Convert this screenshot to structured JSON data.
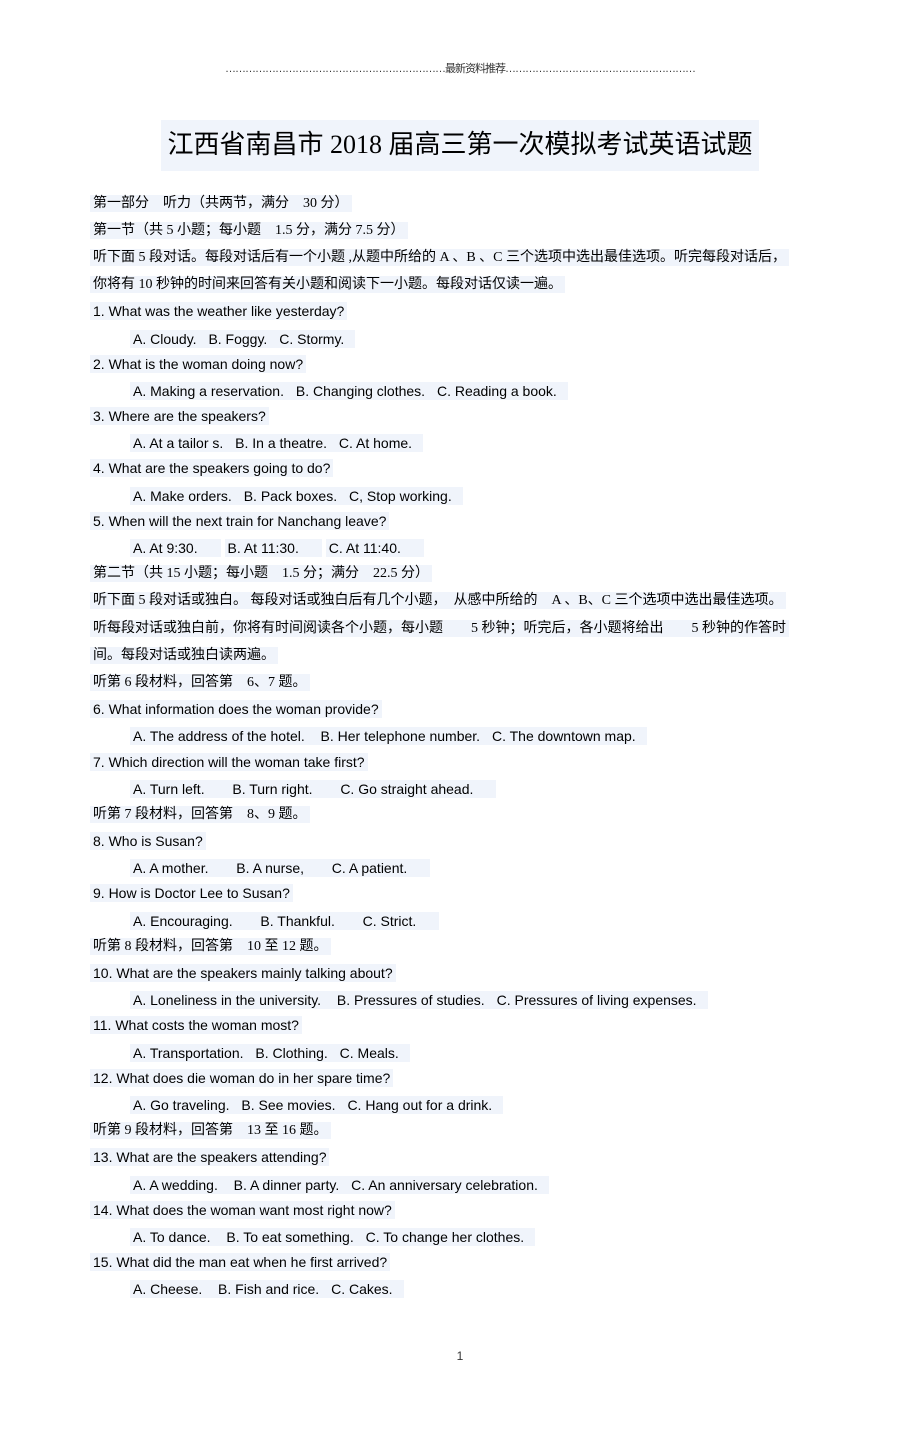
{
  "header_dots": "…………………………………………………………最新资料推荐…………………………………………………",
  "title": "江西省南昌市 2018 届高三第一次模拟考试英语试题",
  "part1_header": "第一部分　听力（共两节，满分　30 分）",
  "section1_header": "第一节（共 5 小题；每小题　1.5 分，满分 7.5 分）",
  "section1_instruction_a": "听下面 5 段对话。每段对话后有一个小题 ,从题中所给的 A 、B 、C 三个选项中选出最佳选项。听完每段对话后，",
  "section1_instruction_b": "你将有 10 秒钟的时间来回答有关小题和阅读下一小题。每段对话仅读一遍。",
  "q1": {
    "text": "1. What was the weather like yesterday?",
    "opts": [
      "A. Cloudy.",
      "B. Foggy.",
      "C. Stormy."
    ]
  },
  "q2": {
    "text": "2. What is the woman doing now?",
    "opts": [
      "A. Making a reservation.",
      "B. Changing clothes.",
      "C. Reading a book."
    ]
  },
  "q3": {
    "text": "3. Where are the speakers?",
    "opts": [
      "A. At a tailor s.",
      "B. In a theatre.",
      "C. At home."
    ]
  },
  "q4": {
    "text": "4. What are the speakers going to do?",
    "opts": [
      "A. Make orders.",
      "B. Pack boxes.",
      "C, Stop working."
    ]
  },
  "q5": {
    "text": "5. When will the next train for Nanchang leave?",
    "opts": [
      "A. At 9:30.",
      "B. At 11:30.",
      "C. At 11:40."
    ]
  },
  "section2_header": "第二节（共 15 小题；每小题　1.5 分；满分　22.5 分）",
  "section2_instruction_a": "听下面 5 段对话或独白。 每段对话或独白后有几个小题，　从感中所给的　A 、B、C 三个选项中选出最佳选项。",
  "section2_instruction_b": "听每段对话或独白前，你将有时间阅读各个小题，每小题　　5 秒钟；听完后，各小题将给出　　5 秒钟的作答时",
  "section2_instruction_c": "间。每段对话或独白读两遍。",
  "material6": "听第 6 段材料，回答第　6、7 题。",
  "q6": {
    "text": "6. What information does the woman provide?",
    "opts": [
      "A. The address of the hotel.",
      "B. Her telephone number.",
      "C. The downtown map."
    ]
  },
  "q7": {
    "text": "7. Which direction will the woman take first?",
    "opts": [
      "A. Turn left.",
      "B. Turn right.",
      "C. Go straight ahead."
    ]
  },
  "material7": "听第 7 段材料，回答第　8、9 题。",
  "q8": {
    "text": "8. Who is Susan?",
    "opts": [
      "A. A mother.",
      "B. A nurse,",
      "C. A patient."
    ]
  },
  "q9": {
    "text": "9. How is Doctor Lee to Susan?",
    "opts": [
      "A. Encouraging.",
      "B. Thankful.",
      "C. Strict."
    ]
  },
  "material8": "听第 8 段材料，回答第　10 至 12 题。",
  "q10": {
    "text": "10. What are the speakers mainly talking about?",
    "opts": [
      "A. Loneliness in the university.",
      "B. Pressures of studies.",
      "C. Pressures of living expenses."
    ]
  },
  "q11": {
    "text": "11. What costs the woman most?",
    "opts": [
      "A. Transportation.",
      "B. Clothing.",
      "C. Meals."
    ]
  },
  "q12": {
    "text": "12. What does die woman do in her spare time?",
    "opts": [
      "A. Go traveling.",
      "B. See movies.",
      "C. Hang out for a drink."
    ]
  },
  "material9": "听第 9 段材料，回答第　13 至 16 题。",
  "q13": {
    "text": "13. What are the speakers attending?",
    "opts": [
      "A. A wedding.",
      "B. A dinner party.",
      "C. An anniversary celebration."
    ]
  },
  "q14": {
    "text": "14. What does the woman want most right now?",
    "opts": [
      "A. To dance.",
      "B. To eat something.",
      "C. To change her clothes."
    ]
  },
  "q15": {
    "text": "15. What did the man eat when he first arrived?",
    "opts": [
      "A. Cheese.",
      "B. Fish and rice.",
      "C. Cakes."
    ]
  },
  "page_number": "1"
}
